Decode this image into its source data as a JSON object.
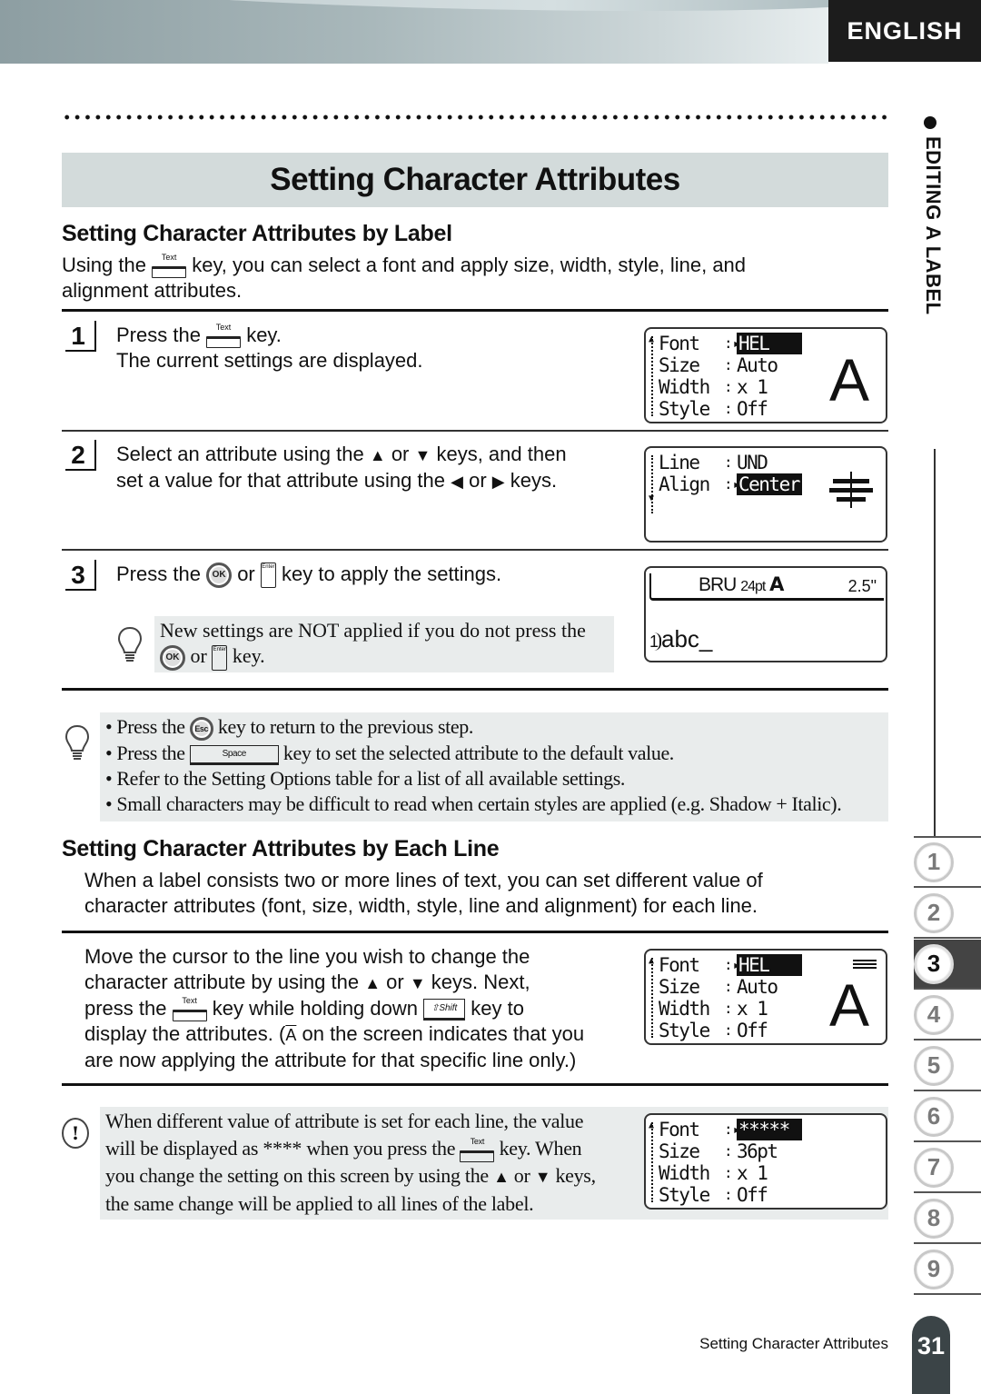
{
  "header": {
    "language": "ENGLISH"
  },
  "side": {
    "section_label": "EDITING A LABEL",
    "chapters": [
      "1",
      "2",
      "3",
      "4",
      "5",
      "6",
      "7",
      "8",
      "9"
    ],
    "active_chapter": "3"
  },
  "title": "Setting Character Attributes",
  "by_label": {
    "heading": "Setting Character Attributes by Label",
    "intro_a": "Using the",
    "intro_b": "key, you can select a font and apply size, width, style, line, and",
    "intro_c": "alignment attributes.",
    "steps": [
      {
        "num": "1",
        "l1a": "Press the",
        "l1b": "key.",
        "l2": "The current settings are displayed."
      },
      {
        "num": "2",
        "l1a": "Select an attribute using the",
        "or": "or",
        "l1b": "keys, and then",
        "l2a": "set a value for that attribute using the",
        "l2b": "keys."
      },
      {
        "num": "3",
        "l1a": "Press the",
        "or": "or",
        "l1b": "key to apply the settings."
      }
    ],
    "step3_note": {
      "l1": "New settings are NOT applied if you do not press the",
      "or": "or",
      "key": "key."
    },
    "tips": [
      {
        "a": "Press the",
        "b": "key to return to the previous step."
      },
      {
        "a": "Press the",
        "b": "key to set the selected attribute to the default value."
      },
      {
        "a": "Refer to the Setting Options table for a list of all available settings."
      },
      {
        "a": "Small characters may be difficult to read when certain styles are applied (e.g. Shadow + Italic)."
      }
    ]
  },
  "keys": {
    "text": "Text",
    "ok": "OK",
    "enter": "Enter",
    "esc": "Esc",
    "space": "Space",
    "shift": "⇧Shift",
    "up": "▲",
    "down": "▼",
    "left": "◀",
    "right": "▶"
  },
  "screens": {
    "screen1": {
      "rows": [
        [
          "Font",
          "HEL"
        ],
        [
          "Size",
          "Auto"
        ],
        [
          "Width",
          "x 1"
        ],
        [
          "Style",
          "Off"
        ]
      ],
      "preview": "A"
    },
    "screen2": {
      "rows": [
        [
          "Line",
          "UND"
        ],
        [
          "Align",
          "Center"
        ]
      ]
    },
    "screen3": {
      "font": "BRU",
      "size": "24pt",
      "style_glyph": "A",
      "length": "2.5\"",
      "line_marker": "1",
      "text": "abc_"
    },
    "screen4": {
      "rows": [
        [
          "Font",
          "HEL"
        ],
        [
          "Size",
          "Auto"
        ],
        [
          "Width",
          "x 1"
        ],
        [
          "Style",
          "Off"
        ]
      ],
      "preview": "A"
    },
    "screen5": {
      "rows": [
        [
          "Font",
          "*****"
        ],
        [
          "Size",
          "36pt"
        ],
        [
          "Width",
          "x 1"
        ],
        [
          "Style",
          "Off"
        ]
      ]
    }
  },
  "by_line": {
    "heading": "Setting Character Attributes by Each Line",
    "intro_l1": "When a label consists two or more lines of text, you can set different value of",
    "intro_l2": "character attributes (font, size, width, style, line and alignment) for each line.",
    "p_l1": "Move the cursor to the line you wish to change the",
    "p_l2a": "character attribute by using the",
    "p_l2or": "or",
    "p_l2b": "keys. Next,",
    "p_l3a": "press the",
    "p_l3b": "key while holding down",
    "p_l3c": "key to",
    "p_l4a": "display the attributes. (",
    "p_l4glyph": "A",
    "p_l4b": "on the screen indicates that you",
    "p_l5": "are now applying the attribute for that specific line only.)",
    "caution_l1": "When different value of attribute is set for each line, the value",
    "caution_l2a": "will be displayed as **** when you press the",
    "caution_l2b": "key. When",
    "caution_l3a": "you change the setting on this screen by using the",
    "caution_l3or": "or",
    "caution_l3b": "keys,",
    "caution_l4": "the same change will be applied to all lines of the label."
  },
  "footer": {
    "title": "Setting Character Attributes",
    "page": "31"
  }
}
